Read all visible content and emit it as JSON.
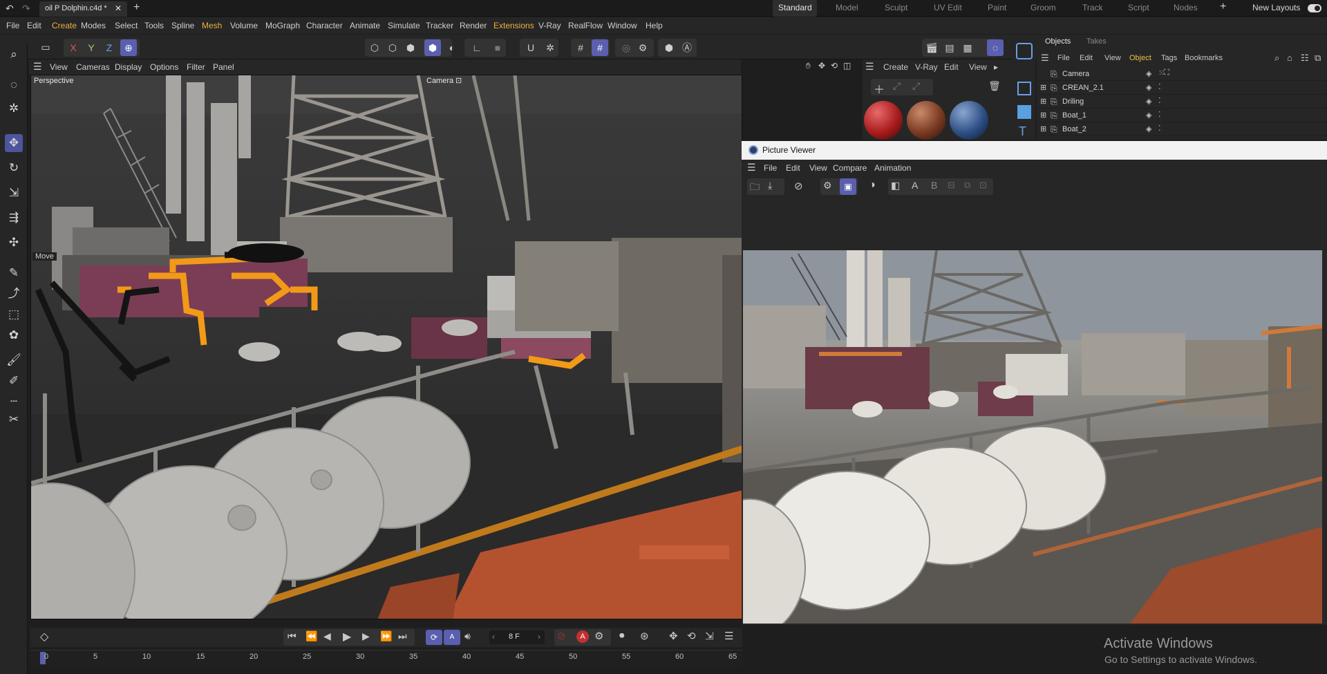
{
  "titlebar": {
    "tab_title": "oil P Dolphin.c4d *",
    "layouts": [
      "Standard",
      "Model",
      "Sculpt",
      "UV Edit",
      "Paint",
      "Groom",
      "Track",
      "Script",
      "Nodes"
    ],
    "active_layout": "Standard",
    "new_layouts_label": "New Layouts"
  },
  "menu": [
    "File",
    "Edit",
    "Create",
    "Modes",
    "Select",
    "Tools",
    "Spline",
    "Mesh",
    "Volume",
    "MoGraph",
    "Character",
    "Animate",
    "Simulate",
    "Tracker",
    "Render",
    "Extensions",
    "V-Ray",
    "RealFlow",
    "Window",
    "Help"
  ],
  "highlight_menus": [
    "Create",
    "Mesh",
    "Extensions"
  ],
  "colors": {
    "accent": "#5a5fb0",
    "highlight_menu": "#f0b040",
    "object_tab": "#f0c040",
    "orange_pipe": "#f29a18",
    "rust": "#b45230"
  },
  "toolbar": {
    "axes": [
      "X",
      "Y",
      "Z"
    ]
  },
  "viewport": {
    "menu": [
      "View",
      "Cameras",
      "Display",
      "Options",
      "Filter",
      "Panel"
    ],
    "label": "Perspective",
    "camera_label": "Camera",
    "move_label": "Move"
  },
  "timeline": {
    "frame_value": "8 F",
    "ruler_ticks": [
      "0",
      "5",
      "10",
      "15",
      "20",
      "25",
      "30",
      "35",
      "40",
      "45",
      "50",
      "55",
      "60",
      "65"
    ]
  },
  "materials": {
    "menu": [
      "Create",
      "V-Ray",
      "Edit",
      "View"
    ]
  },
  "objects": {
    "tabs": [
      "Objects",
      "Takes"
    ],
    "menu": [
      "File",
      "Edit",
      "View",
      "Object",
      "Tags",
      "Bookmarks"
    ],
    "items": [
      "Camera",
      "CREAN_2.1",
      "Driling",
      "Boat_1",
      "Boat_2"
    ]
  },
  "picture_viewer": {
    "title": "Picture Viewer",
    "menu": [
      "File",
      "Edit",
      "View",
      "Compare",
      "Animation"
    ],
    "compare_a": "A",
    "compare_b": "B"
  },
  "watermark": {
    "line1": "Activate Windows",
    "line2": "Go to Settings to activate Windows."
  }
}
